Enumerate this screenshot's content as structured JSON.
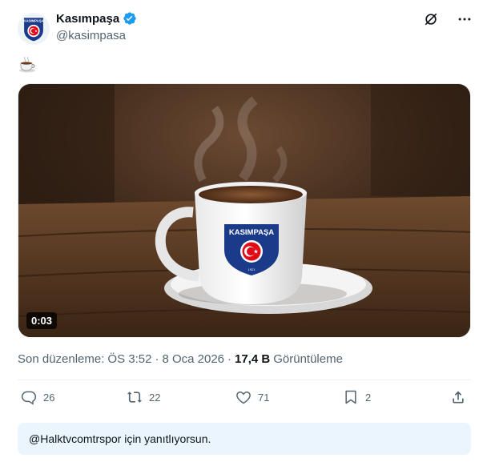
{
  "author": {
    "name": "Kasımpaşa",
    "handle": "@kasimpasa",
    "verified": true
  },
  "post": {
    "text_emoji": "coffee-cup-emoji",
    "media": {
      "duration": "0:03",
      "logo_text": "KASIMPAŞA",
      "logo_year": "1921"
    },
    "meta": {
      "edited_label": "Son düzenleme:",
      "time": "ÖS 3:52",
      "dot1": "·",
      "date": "8 Oca 2026",
      "dot2": "·",
      "views_count": "17,4 B",
      "views_label": "Görüntüleme"
    }
  },
  "actions": {
    "replies": "26",
    "reposts": "22",
    "likes": "71",
    "bookmarks": "2"
  },
  "reply_bar": {
    "text": "@Halktvcomtrspor için yanıtlıyorsun."
  },
  "colors": {
    "accent": "#1d9bf0",
    "text_primary": "#0f1419",
    "text_secondary": "#536471",
    "reply_bg": "#eaf5fd",
    "brand_navy": "#1a3a8a",
    "brand_red": "#e30a17"
  }
}
